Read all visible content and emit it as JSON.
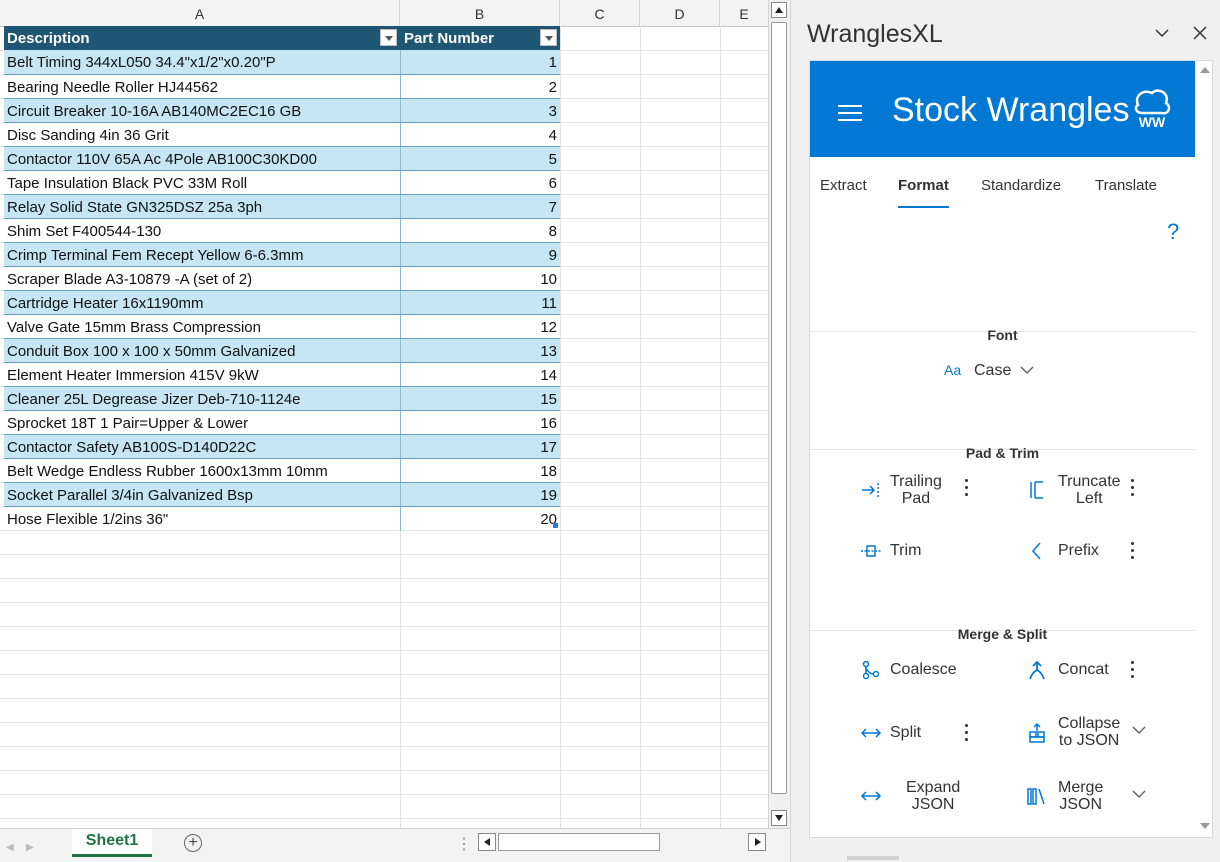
{
  "columns": [
    "A",
    "B",
    "C",
    "D",
    "E"
  ],
  "table": {
    "header": {
      "description": "Description",
      "part_number": "Part Number"
    },
    "rows": [
      {
        "description": "Belt Timing 344xL050 34.4\"x1/2\"x0.20\"P",
        "part_number": "1"
      },
      {
        "description": "Bearing Needle Roller HJ44562",
        "part_number": "2"
      },
      {
        "description": "Circuit Breaker 10-16A AB140MC2EC16 GB",
        "part_number": "3"
      },
      {
        "description": "Disc Sanding 4in 36 Grit",
        "part_number": "4"
      },
      {
        "description": "Contactor 110V 65A Ac 4Pole AB100C30KD00",
        "part_number": "5"
      },
      {
        "description": "Tape Insulation Black PVC 33M Roll",
        "part_number": "6"
      },
      {
        "description": "Relay Solid State GN325DSZ 25a 3ph",
        "part_number": "7"
      },
      {
        "description": "Shim Set F400544-130",
        "part_number": "8"
      },
      {
        "description": "Crimp Terminal Fem Recept Yellow 6-6.3mm",
        "part_number": "9"
      },
      {
        "description": "Scraper Blade A3-10879 -A (set of 2)",
        "part_number": "10"
      },
      {
        "description": "Cartridge Heater 16x1190mm",
        "part_number": "11"
      },
      {
        "description": "Valve Gate 15mm Brass Compression",
        "part_number": "12"
      },
      {
        "description": "Conduit Box 100 x 100 x 50mm Galvanized",
        "part_number": "13"
      },
      {
        "description": "Element Heater Immersion 415V 9kW",
        "part_number": "14"
      },
      {
        "description": "Cleaner 25L Degrease Jizer Deb-710-1124e",
        "part_number": "15"
      },
      {
        "description": "Sprocket 18T 1 Pair=Upper & Lower",
        "part_number": "16"
      },
      {
        "description": "Contactor Safety AB100S-D140D22C",
        "part_number": "17"
      },
      {
        "description": "Belt Wedge Endless Rubber 1600x13mm 10mm",
        "part_number": "18"
      },
      {
        "description": "Socket Parallel 3/4in Galvanized Bsp",
        "part_number": "19"
      },
      {
        "description": "Hose Flexible 1/2ins 36\"",
        "part_number": "20"
      }
    ]
  },
  "sheet_tab": "Sheet1",
  "add_sheet_label": "+",
  "pane": {
    "title": "WranglesXL",
    "brand": "Stock Wrangles",
    "logo_text": "WW",
    "tabs": [
      "Extract",
      "Format",
      "Standardize",
      "Translate"
    ],
    "active_tab": "Format",
    "help": "?",
    "sections": {
      "font": {
        "title": "Font",
        "case_label": "Case",
        "case_icon_text": "Aa"
      },
      "pad_trim": {
        "title": "Pad & Trim",
        "trailing_pad": [
          "Trailing",
          "Pad"
        ],
        "truncate_left": [
          "Truncate",
          "Left"
        ],
        "trim": "Trim",
        "prefix": "Prefix"
      },
      "merge_split": {
        "title": "Merge & Split",
        "coalesce": "Coalesce",
        "concat": "Concat",
        "split": "Split",
        "collapse_to_json": [
          "Collapse",
          "to JSON"
        ],
        "expand_json": [
          "Expand",
          "JSON"
        ],
        "merge_json": [
          "Merge",
          "JSON"
        ]
      }
    }
  },
  "colors": {
    "table_header": "#1f5673",
    "band_row": "#c5e6f2",
    "accent": "#0078d4",
    "sheet_tab": "#217346"
  }
}
